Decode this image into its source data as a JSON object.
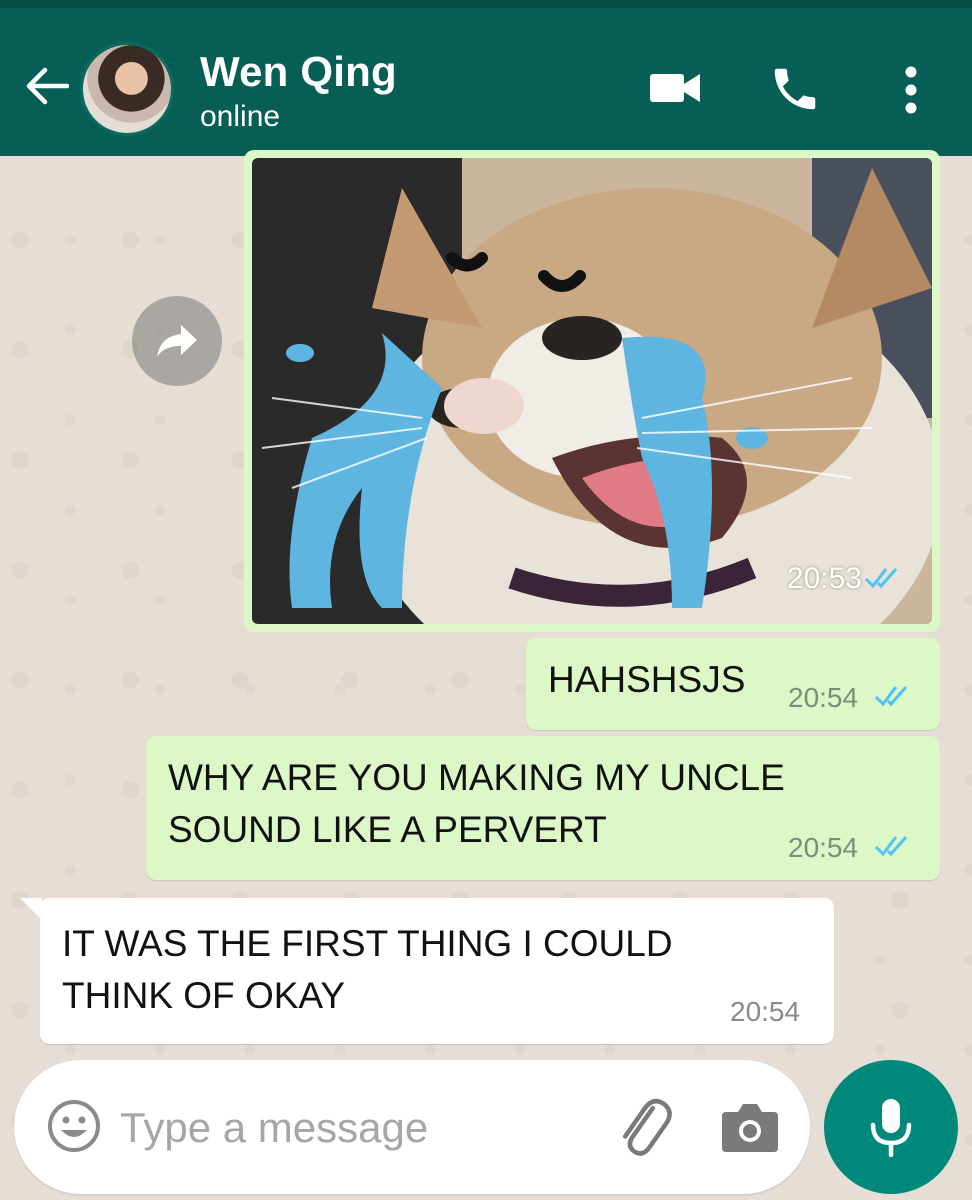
{
  "header": {
    "contact_name": "Wen Qing",
    "contact_status": "online",
    "icons": [
      "back-arrow-icon",
      "video-call-icon",
      "phone-icon",
      "more-menu-icon"
    ]
  },
  "messages": [
    {
      "type": "image",
      "direction": "outgoing",
      "time": "20:53",
      "status": "read"
    },
    {
      "type": "text",
      "direction": "outgoing",
      "text": "HAHSHSJS",
      "time": "20:54",
      "status": "read"
    },
    {
      "type": "text",
      "direction": "outgoing",
      "text_line1": "WHY ARE YOU MAKING MY UNCLE",
      "text_line2": "SOUND LIKE A PERVERT",
      "time": "20:54",
      "status": "read"
    },
    {
      "type": "text",
      "direction": "incoming",
      "text_line1": "IT WAS THE FIRST THING I COULD",
      "text_line2": "THINK OF OKAY",
      "time": "20:54"
    }
  ],
  "composer": {
    "placeholder": "Type a message",
    "icons": [
      "emoji-icon",
      "attach-icon",
      "camera-icon",
      "mic-icon"
    ]
  },
  "colors": {
    "header": "#075e54",
    "outgoing_bubble": "#dcf8c6",
    "incoming_bubble": "#ffffff",
    "read_ticks": "#4fc3f7",
    "mic_button": "#00897b"
  }
}
